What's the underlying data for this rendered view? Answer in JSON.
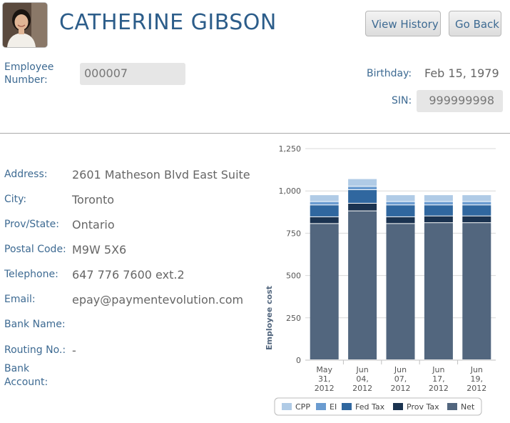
{
  "employee": {
    "name": "CATHERINE GIBSON",
    "number_label": "Employee Number:",
    "number_value": "000007",
    "birthday_label": "Birthday:",
    "birthday_value": "Feb 15, 1979",
    "sin_label": "SIN:",
    "sin_value": "999999998"
  },
  "buttons": {
    "view_history": "View History",
    "go_back": "Go Back"
  },
  "details": [
    {
      "label": "Address:",
      "value": "2601 Matheson Blvd East Suite"
    },
    {
      "label": "City:",
      "value": "Toronto"
    },
    {
      "label": "Prov/State:",
      "value": "Ontario"
    },
    {
      "label": "Postal Code:",
      "value": "M9W 5X6"
    },
    {
      "label": "Telephone:",
      "value": "647 776 7600 ext.2"
    },
    {
      "label": "Email:",
      "value": "epay@paymentevolution.com"
    },
    {
      "label": "Bank Name:",
      "value": ""
    },
    {
      "label": "Routing No.:",
      "value": "-"
    },
    {
      "label": "Bank Account:",
      "value": ""
    }
  ],
  "chart_data": {
    "type": "bar",
    "stacked": true,
    "ylabel": "Employee cost",
    "ylim": [
      0,
      1250
    ],
    "yticks": [
      "0",
      "250",
      "500",
      "750",
      "1,000",
      "1,250"
    ],
    "categories": [
      [
        "May",
        "31,",
        "2012"
      ],
      [
        "Jun",
        "04,",
        "2012"
      ],
      [
        "Jun",
        "07,",
        "2012"
      ],
      [
        "Jun",
        "17,",
        "2012"
      ],
      [
        "Jun",
        "19,",
        "2012"
      ]
    ],
    "series": [
      {
        "name": "Net",
        "color": "#52667e",
        "values": [
          805,
          880,
          805,
          810,
          810
        ]
      },
      {
        "name": "Prov Tax",
        "color": "#1b3350",
        "values": [
          40,
          45,
          40,
          40,
          40
        ]
      },
      {
        "name": "Fed Tax",
        "color": "#30679f",
        "values": [
          70,
          80,
          70,
          65,
          65
        ]
      },
      {
        "name": "EI",
        "color": "#6b9cd0",
        "values": [
          20,
          20,
          20,
          20,
          20
        ]
      },
      {
        "name": "CPP",
        "color": "#b0cbe6",
        "values": [
          40,
          45,
          40,
          40,
          40
        ]
      }
    ],
    "legend": [
      "CPP",
      "EI",
      "Fed Tax",
      "Prov Tax",
      "Net"
    ],
    "legend_position": "bottom",
    "grid": true
  },
  "icons": {
    "avatar": "employee-photo"
  }
}
